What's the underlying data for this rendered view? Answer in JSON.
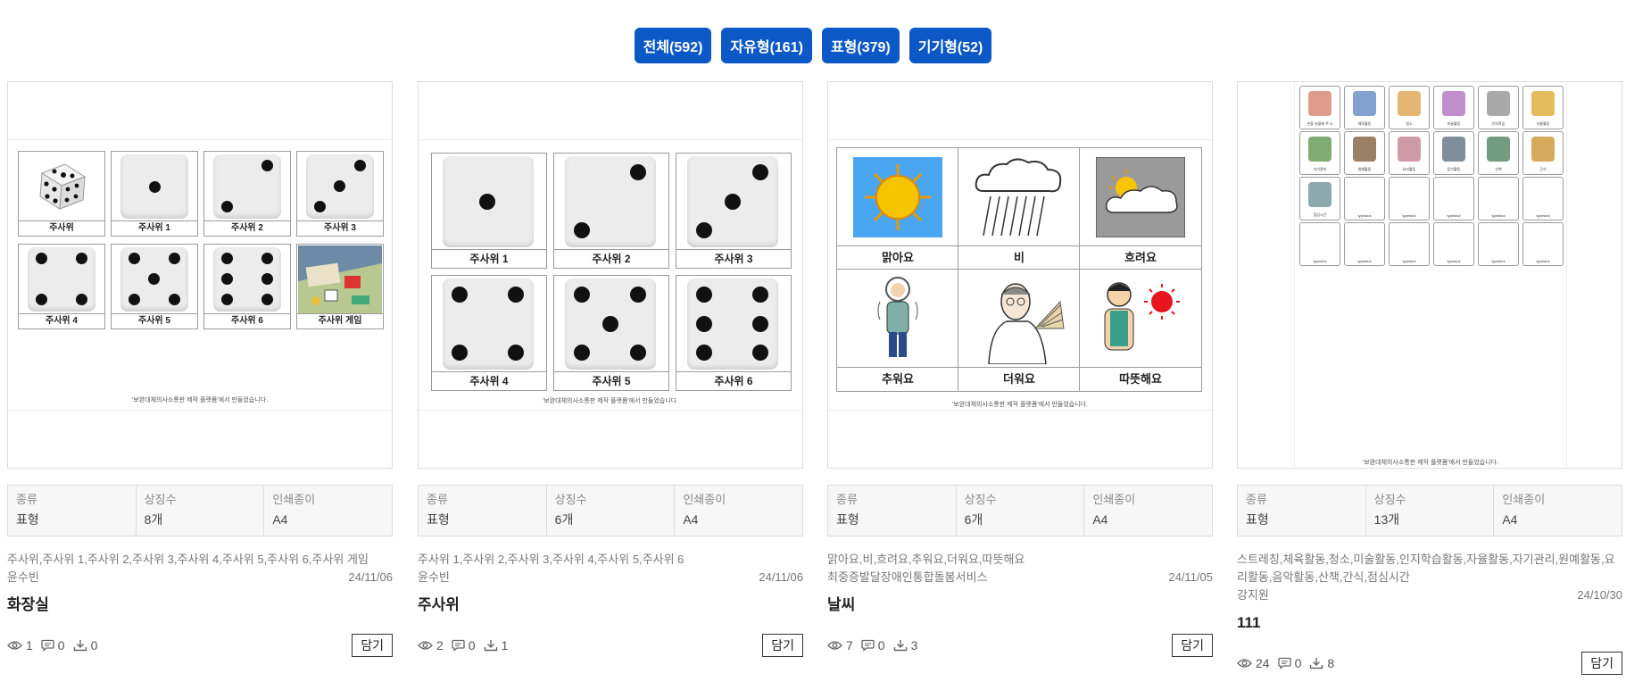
{
  "filters": [
    {
      "label": "전체(592)"
    },
    {
      "label": "자유형(161)"
    },
    {
      "label": "표형(379)"
    },
    {
      "label": "기기형(52)"
    }
  ],
  "meta_labels": {
    "type": "종류",
    "symbols": "상징수",
    "paper": "인쇄종이"
  },
  "save_label": "담기",
  "icons": {
    "views": "eye-icon",
    "comments": "comment-icon",
    "downloads": "download-icon"
  },
  "credit": "'보완대체의사소통판 제작 플랫폼'에서 만들었습니다.",
  "colors": {
    "accent": "#0b58c6",
    "sky": "#4aa6f0",
    "gray_sky": "#9a9a9a"
  },
  "cards": [
    {
      "board": [
        "주사위",
        "주사위 1",
        "주사위 2",
        "주사위 3",
        "주사위 4",
        "주사위 5",
        "주사위 6",
        "주사위 게임"
      ],
      "type": "표형",
      "symbols": "8개",
      "paper": "A4",
      "tags": "주사위,주사위 1,주사위 2,주사위 3,주사위 4,주사위 5,주사위 6,주사위 게임",
      "author": "윤수빈",
      "date": "24/11/06",
      "title": "화장실",
      "views": "1",
      "comments": "0",
      "downloads": "0"
    },
    {
      "board": [
        "주사위 1",
        "주사위 2",
        "주사위 3",
        "주사위 4",
        "주사위 5",
        "주사위 6"
      ],
      "type": "표형",
      "symbols": "6개",
      "paper": "A4",
      "tags": "주사위 1,주사위 2,주사위 3,주사위 4,주사위 5,주사위 6",
      "author": "윤수빈",
      "date": "24/11/06",
      "title": "주사위",
      "views": "2",
      "comments": "0",
      "downloads": "1"
    },
    {
      "board": [
        "맑아요",
        "비",
        "흐려요",
        "추워요",
        "더워요",
        "따뜻해요"
      ],
      "type": "표형",
      "symbols": "6개",
      "paper": "A4",
      "tags": "맑아요,비,흐려요,추워요,더워요,따뜻해요",
      "author": "최중증발달장애인통합돌봄서비스",
      "date": "24/11/05",
      "title": "날씨",
      "views": "7",
      "comments": "0",
      "downloads": "3"
    },
    {
      "board": [
        "손을 씻을때 주 스",
        "체육활동",
        "청소",
        "미술활동",
        "인지학습",
        "자율활동",
        "자기관리",
        "원예활동",
        "요리활동",
        "음악활동",
        "산책",
        "간식",
        "점심시간",
        "typesbol",
        "typesbol",
        "typesbol",
        "typesbol",
        "typesbol",
        "typesbol",
        "typesbol",
        "typesbol",
        "typesbol",
        "typesbol",
        "typesbol"
      ],
      "type": "표형",
      "symbols": "13개",
      "paper": "A4",
      "tags": "스트레칭,체육활동,청소,미술활동,인지학습활동,자율활동,자기관리,원예활동,요리활동,음악활동,산책,간식,점심시간",
      "author": "강지원",
      "date": "24/10/30",
      "title": "111",
      "views": "24",
      "comments": "0",
      "downloads": "8"
    }
  ]
}
